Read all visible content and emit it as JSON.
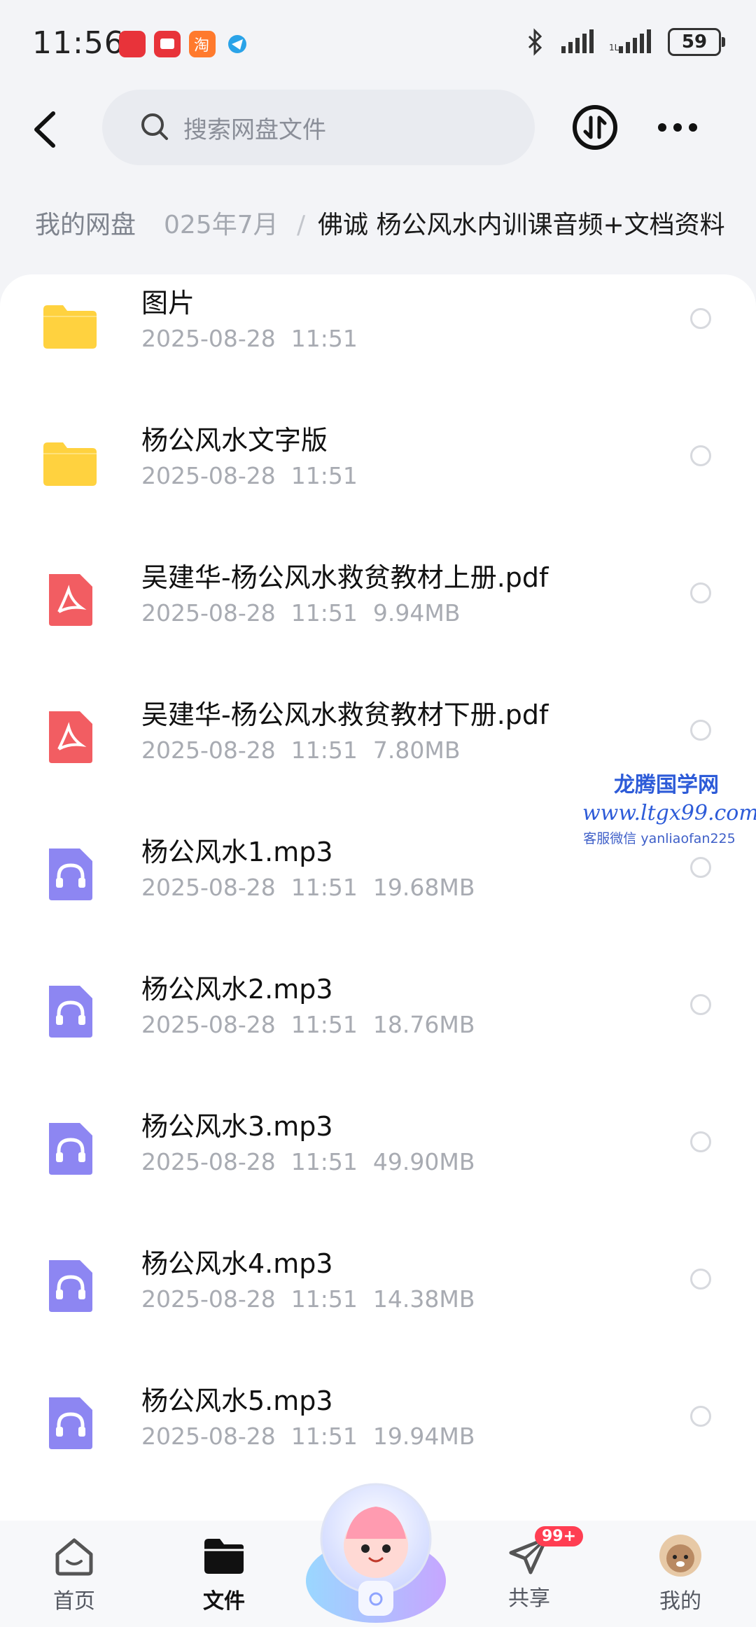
{
  "status_bar": {
    "time": "11:56",
    "battery": "59"
  },
  "header": {
    "search_placeholder": "搜索网盘文件"
  },
  "breadcrumb": {
    "root": "我的网盘",
    "middle": "025年7月",
    "separator": "/",
    "current": "佛诚 杨公风水内训课音频+文档资料"
  },
  "files": [
    {
      "name": "图片",
      "date": "2025-08-28",
      "time": "11:51",
      "size": "",
      "type": "folder"
    },
    {
      "name": "杨公风水文字版",
      "date": "2025-08-28",
      "time": "11:51",
      "size": "",
      "type": "folder"
    },
    {
      "name": "吴建华-杨公风水救贫教材上册.pdf",
      "date": "2025-08-28",
      "time": "11:51",
      "size": "9.94MB",
      "type": "pdf"
    },
    {
      "name": "吴建华-杨公风水救贫教材下册.pdf",
      "date": "2025-08-28",
      "time": "11:51",
      "size": "7.80MB",
      "type": "pdf"
    },
    {
      "name": "杨公风水1.mp3",
      "date": "2025-08-28",
      "time": "11:51",
      "size": "19.68MB",
      "type": "audio"
    },
    {
      "name": "杨公风水2.mp3",
      "date": "2025-08-28",
      "time": "11:51",
      "size": "18.76MB",
      "type": "audio"
    },
    {
      "name": "杨公风水3.mp3",
      "date": "2025-08-28",
      "time": "11:51",
      "size": "49.90MB",
      "type": "audio"
    },
    {
      "name": "杨公风水4.mp3",
      "date": "2025-08-28",
      "time": "11:51",
      "size": "14.38MB",
      "type": "audio"
    },
    {
      "name": "杨公风水5.mp3",
      "date": "2025-08-28",
      "time": "11:51",
      "size": "19.94MB",
      "type": "audio"
    }
  ],
  "watermark": {
    "line1": "龙腾国学网",
    "line2": "www.ltgx99.com",
    "line3": "客服微信 yanliaofan225"
  },
  "bottom_nav": {
    "home": "首页",
    "files": "文件",
    "share": "共享",
    "share_badge": "99+",
    "me": "我的"
  },
  "colors": {
    "folder": "#ffd23f",
    "pdf": "#f25d62",
    "audio": "#8d86f2",
    "accent": "#2d5bd8"
  }
}
